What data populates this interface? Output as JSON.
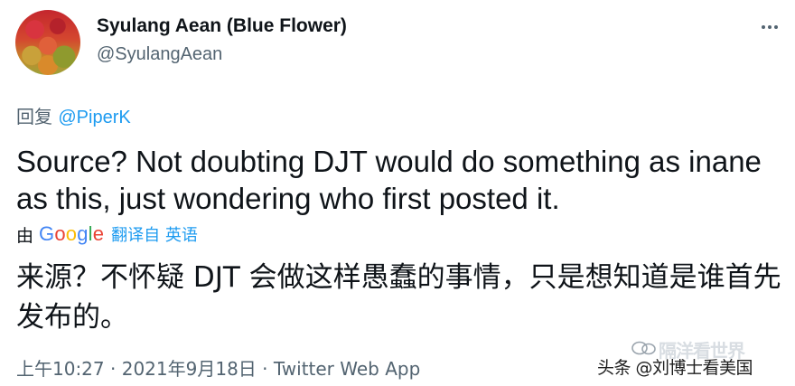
{
  "author": {
    "name": "Syulang Aean (Blue Flower)",
    "handle": "@SyulangAean"
  },
  "reply_to": {
    "prefix": "回复 ",
    "mention": "@PiperK"
  },
  "tweet": {
    "text": "Source?  Not doubting DJT would do something as inane as this, just wondering who first posted it."
  },
  "translation": {
    "by_label": "由",
    "provider_letters": [
      "G",
      "o",
      "o",
      "g",
      "l",
      "e"
    ],
    "link_label": "翻译自 英语",
    "text": "来源？不怀疑 DJT 会做这样愚蠢的事情，只是想知道是谁首先发布的。"
  },
  "meta": {
    "time": "上午10:27",
    "separator": " · ",
    "date": "2021年9月18日",
    "source": "Twitter Web App"
  },
  "watermark": {
    "top": "隔洋看世界",
    "bottom": "头条 @刘博士看美国",
    "icon": "watermark-icon"
  },
  "colors": {
    "accent": "#1d9bf0",
    "secondary_text": "#536471",
    "primary_text": "#0f1419"
  },
  "icons": {
    "more": "more-icon"
  }
}
